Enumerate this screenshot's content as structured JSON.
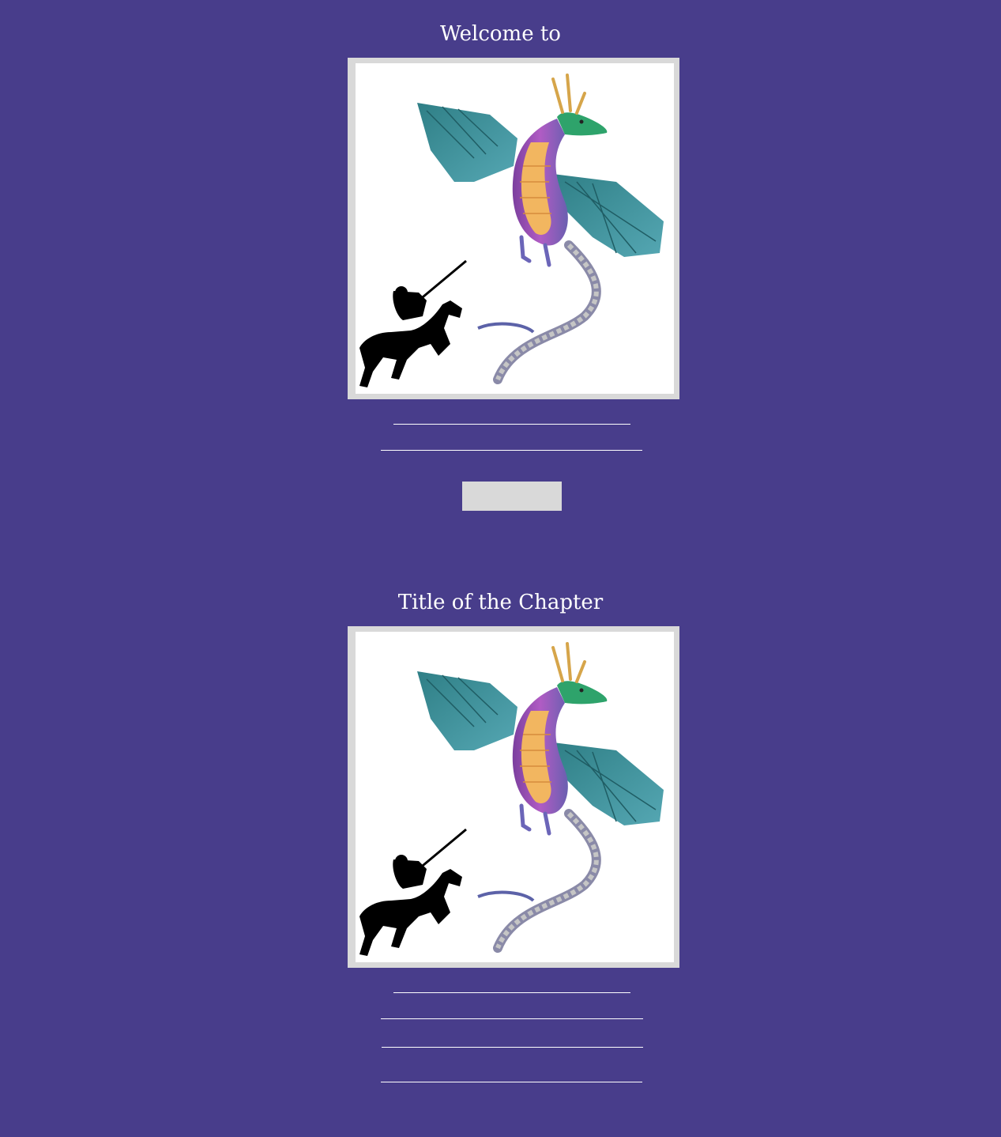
{
  "welcome": {
    "title": "Welcome to",
    "button_label": ""
  },
  "chapter": {
    "title": "Title of the Chapter"
  },
  "colors": {
    "background": "#483d8b",
    "frame": "#d9d9d9",
    "text": "#ffffff"
  },
  "illustration": {
    "subject": "dragon-and-knight-illustration"
  }
}
